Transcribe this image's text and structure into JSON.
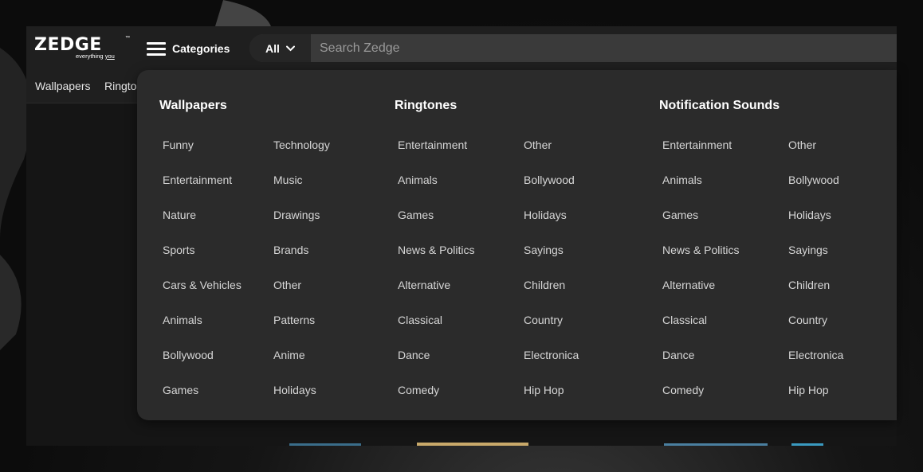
{
  "logo": {
    "word": "ZEDGE",
    "tm": "™",
    "tagline_prefix": "everything ",
    "tagline_you": "you"
  },
  "header": {
    "categories_label": "Categories"
  },
  "search": {
    "scope_label": "All",
    "placeholder": "Search Zedge"
  },
  "subnav": {
    "items": [
      "Wallpapers",
      "Ringto"
    ]
  },
  "menu": {
    "wallpapers": {
      "title": "Wallpapers",
      "col1": [
        "Funny",
        "Entertainment",
        "Nature",
        "Sports",
        "Cars & Vehicles",
        "Animals",
        "Bollywood",
        "Games"
      ],
      "col2": [
        "Technology",
        "Music",
        "Drawings",
        "Brands",
        "Other",
        "Patterns",
        "Anime",
        "Holidays"
      ]
    },
    "ringtones": {
      "title": "Ringtones",
      "col1": [
        "Entertainment",
        "Animals",
        "Games",
        "News & Politics",
        "Alternative",
        "Classical",
        "Dance",
        "Comedy"
      ],
      "col2": [
        "Other",
        "Bollywood",
        "Holidays",
        "Sayings",
        "Children",
        "Country",
        "Electronica",
        "Hip Hop"
      ]
    },
    "notification_sounds": {
      "title": "Notification Sounds",
      "col1": [
        "Entertainment",
        "Animals",
        "Games",
        "News & Politics",
        "Alternative",
        "Classical",
        "Dance",
        "Comedy"
      ],
      "col2": [
        "Other",
        "Bollywood",
        "Holidays",
        "Sayings",
        "Children",
        "Country",
        "Electronica",
        "Hip Hop"
      ]
    }
  },
  "colors": {
    "dropdown_bg": "#2b2b2b",
    "header_bg": "#1f1f1f",
    "search_bg": "#3a3a3a",
    "link_text": "#d6d6d6"
  },
  "icons": {
    "menu": "hamburger-icon",
    "scope": "chevron-down-icon"
  }
}
